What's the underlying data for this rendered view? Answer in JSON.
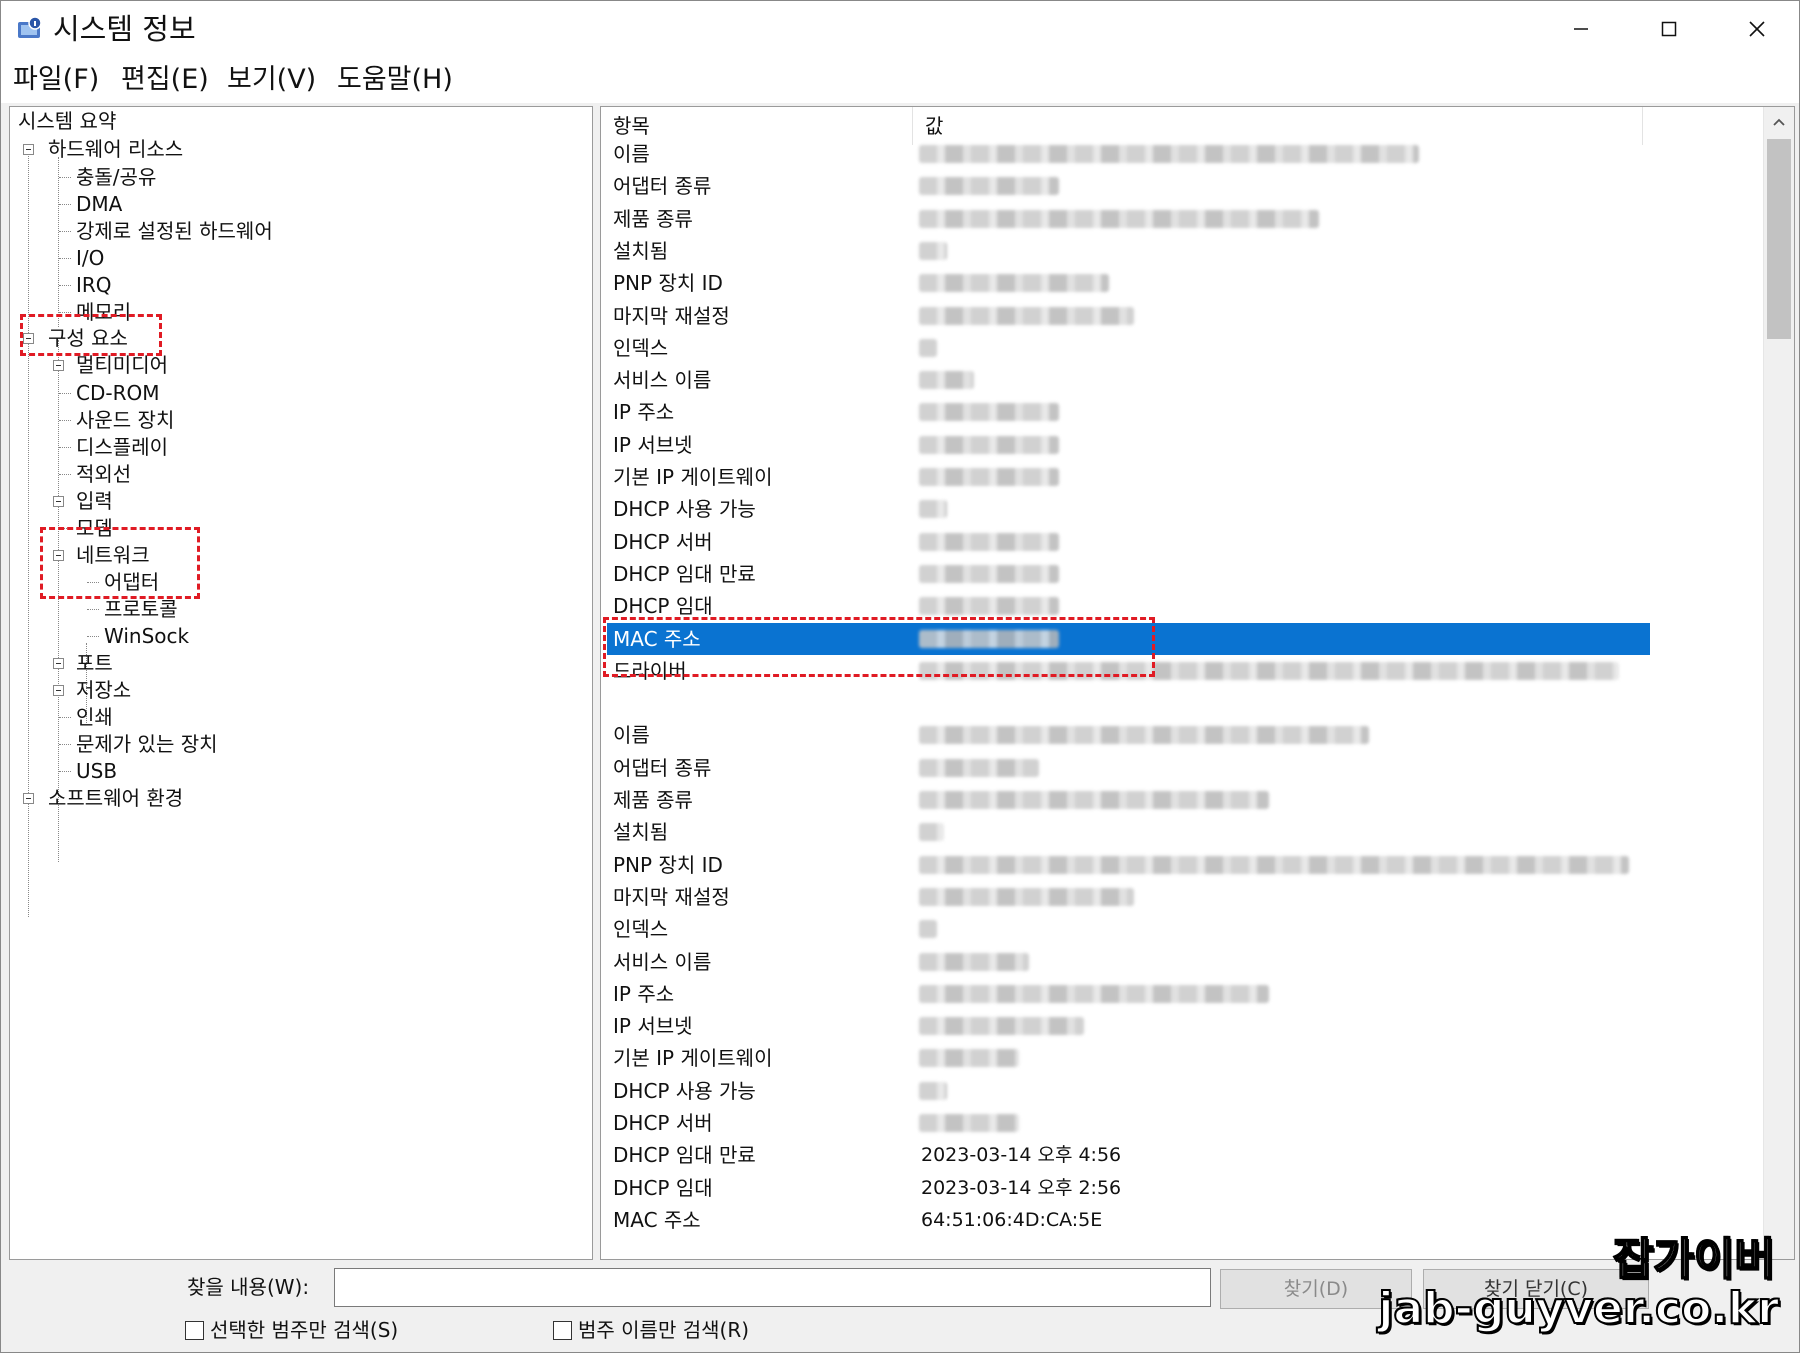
{
  "window": {
    "title": "시스템 정보",
    "minimize_glyph": "—",
    "maximize_glyph": "☐",
    "close_glyph": "✕"
  },
  "menu": [
    "파일(F)",
    "편집(E)",
    "보기(V)",
    "도움말(H)"
  ],
  "tree": {
    "system_summary": "시스템 요약",
    "hardware_resources": "하드웨어 리소스",
    "hw_children": [
      "충돌/공유",
      "DMA",
      "강제로 설정된 하드웨어",
      "I/O",
      "IRQ",
      "메모리"
    ],
    "components": "구성 요소",
    "comp_children": [
      "멀티미디어",
      "CD-ROM",
      "사운드 장치",
      "디스플레이",
      "적외선",
      "입력",
      "모뎀"
    ],
    "network": "네트워크",
    "net_children": [
      "어댑터",
      "프로토콜",
      "WinSock"
    ],
    "comp_children_after": [
      "포트",
      "저장소",
      "인쇄",
      "문제가 있는 장치",
      "USB"
    ],
    "software_env": "소프트웨어 환경"
  },
  "list": {
    "header_item": "항목",
    "header_value": "값",
    "group1_labels": [
      "이름",
      "어댑터 종류",
      "제품 종류",
      "설치됨",
      "PNP 장치 ID",
      "마지막 재설정",
      "인덱스",
      "서비스 이름",
      "IP 주소",
      "IP 서브넷",
      "기본 IP 게이트웨이",
      "DHCP 사용 가능",
      "DHCP 서버",
      "DHCP 임대 만료",
      "DHCP 임대",
      "MAC 주소",
      "드라이버"
    ],
    "group2_labels": [
      "이름",
      "어댑터 종류",
      "제품 종류",
      "설치됨",
      "PNP 장치 ID",
      "마지막 재설정",
      "인덱스",
      "서비스 이름",
      "IP 주소",
      "IP 서브넷",
      "기본 IP 게이트웨이",
      "DHCP 사용 가능",
      "DHCP 서버",
      "DHCP 임대 만료",
      "DHCP 임대",
      "MAC 주소"
    ],
    "dhcp_lease_expires": "2023-03-14 오후 4:56",
    "dhcp_lease_obtained": "2023-03-14 오후 2:56",
    "mac_address": "64:51:06:4D:CA:5E"
  },
  "search": {
    "label": "찾을 내용(W):",
    "value": "",
    "find_button": "찾기(D)",
    "close_find_button": "찾기 닫기(C)",
    "check_selected": "선택한 범주만 검색(S)",
    "check_names": "범주 이름만 검색(R)"
  },
  "watermark": {
    "line1": "잡가이버",
    "line2": "jab-guyver.co.kr"
  },
  "colors": {
    "selection": "#0a73d1",
    "highlight_box": "#e01b24"
  }
}
